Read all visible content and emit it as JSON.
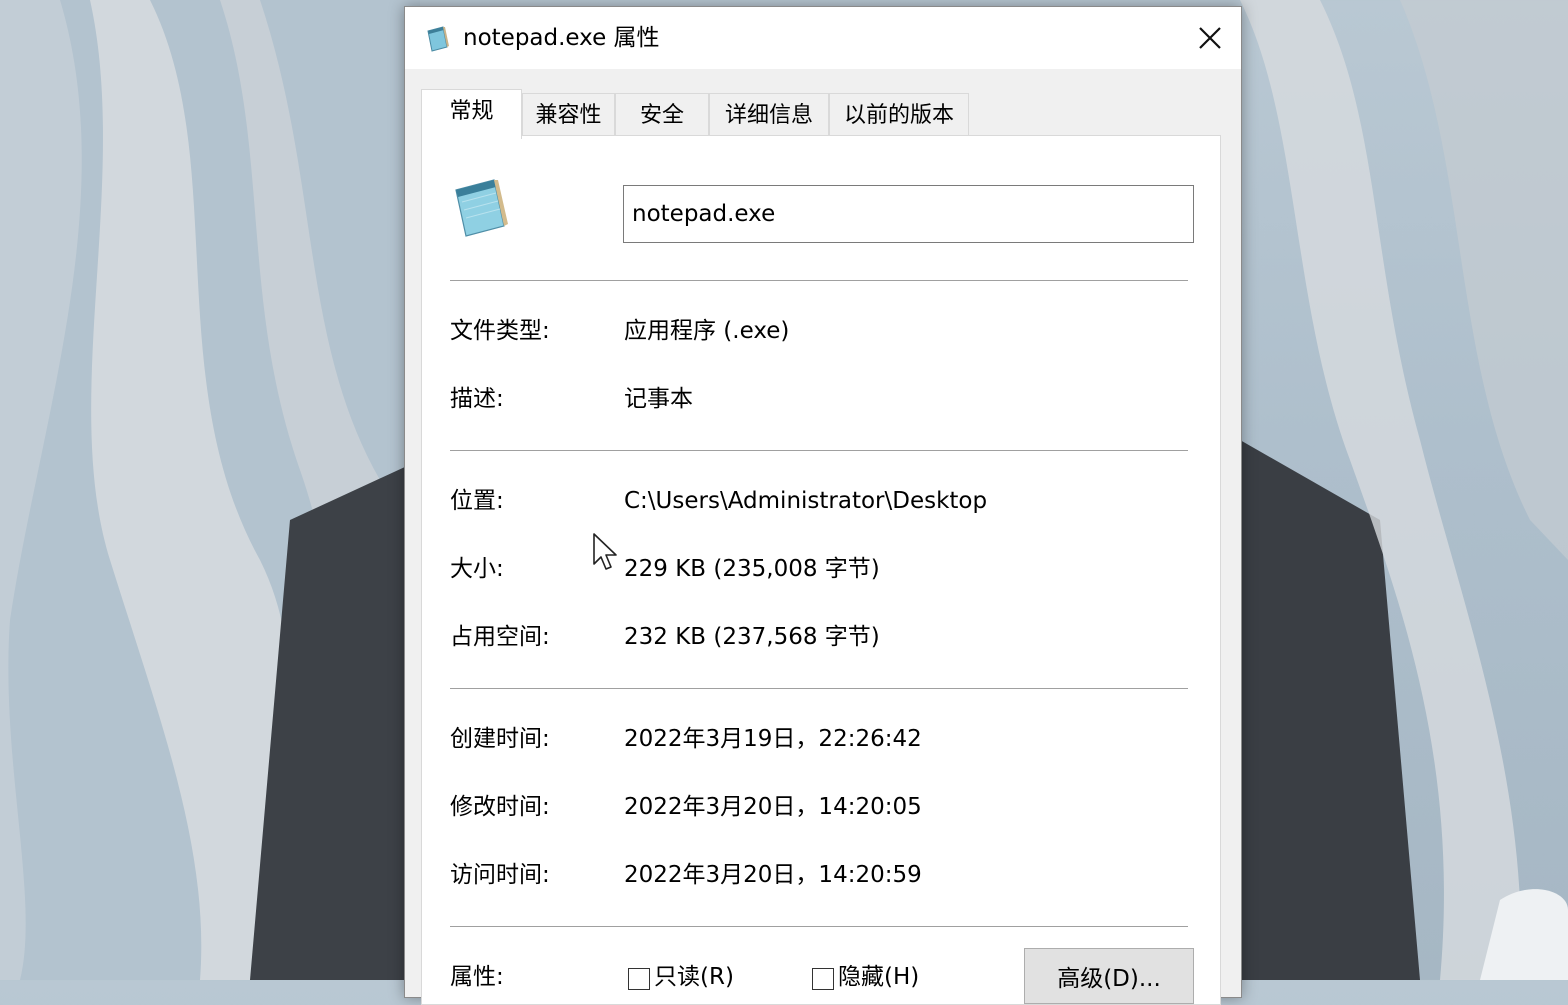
{
  "window": {
    "title": "notepad.exe 属性",
    "close_label": "✕"
  },
  "tabs": [
    {
      "label": "常规",
      "active": true
    },
    {
      "label": "兼容性",
      "active": false
    },
    {
      "label": "安全",
      "active": false
    },
    {
      "label": "详细信息",
      "active": false
    },
    {
      "label": "以前的版本",
      "active": false
    }
  ],
  "general": {
    "file_name": "notepad.exe",
    "file_type_label": "文件类型:",
    "file_type_value": "应用程序 (.exe)",
    "description_label": "描述:",
    "description_value": "记事本",
    "location_label": "位置:",
    "location_value": "C:\\Users\\Administrator\\Desktop",
    "size_label": "大小:",
    "size_value": "229 KB (235,008 字节)",
    "size_on_disk_label": "占用空间:",
    "size_on_disk_value": "232 KB (237,568 字节)",
    "created_label": "创建时间:",
    "created_value": "2022年3月19日，22:26:42",
    "modified_label": "修改时间:",
    "modified_value": "2022年3月20日，14:20:05",
    "accessed_label": "访问时间:",
    "accessed_value": "2022年3月20日，14:20:59",
    "attributes_label": "属性:",
    "readonly_label": "只读(R)",
    "hidden_label": "隐藏(H)",
    "advanced_button": "高级(D)..."
  },
  "icons": {
    "app_icon": "notepad-icon",
    "close_icon": "close-icon",
    "cursor": "mouse-pointer-icon"
  },
  "colors": {
    "dialog_bg": "#f0f0f0",
    "panel_bg": "#ffffff",
    "wallpaper": "#aebfcc"
  }
}
